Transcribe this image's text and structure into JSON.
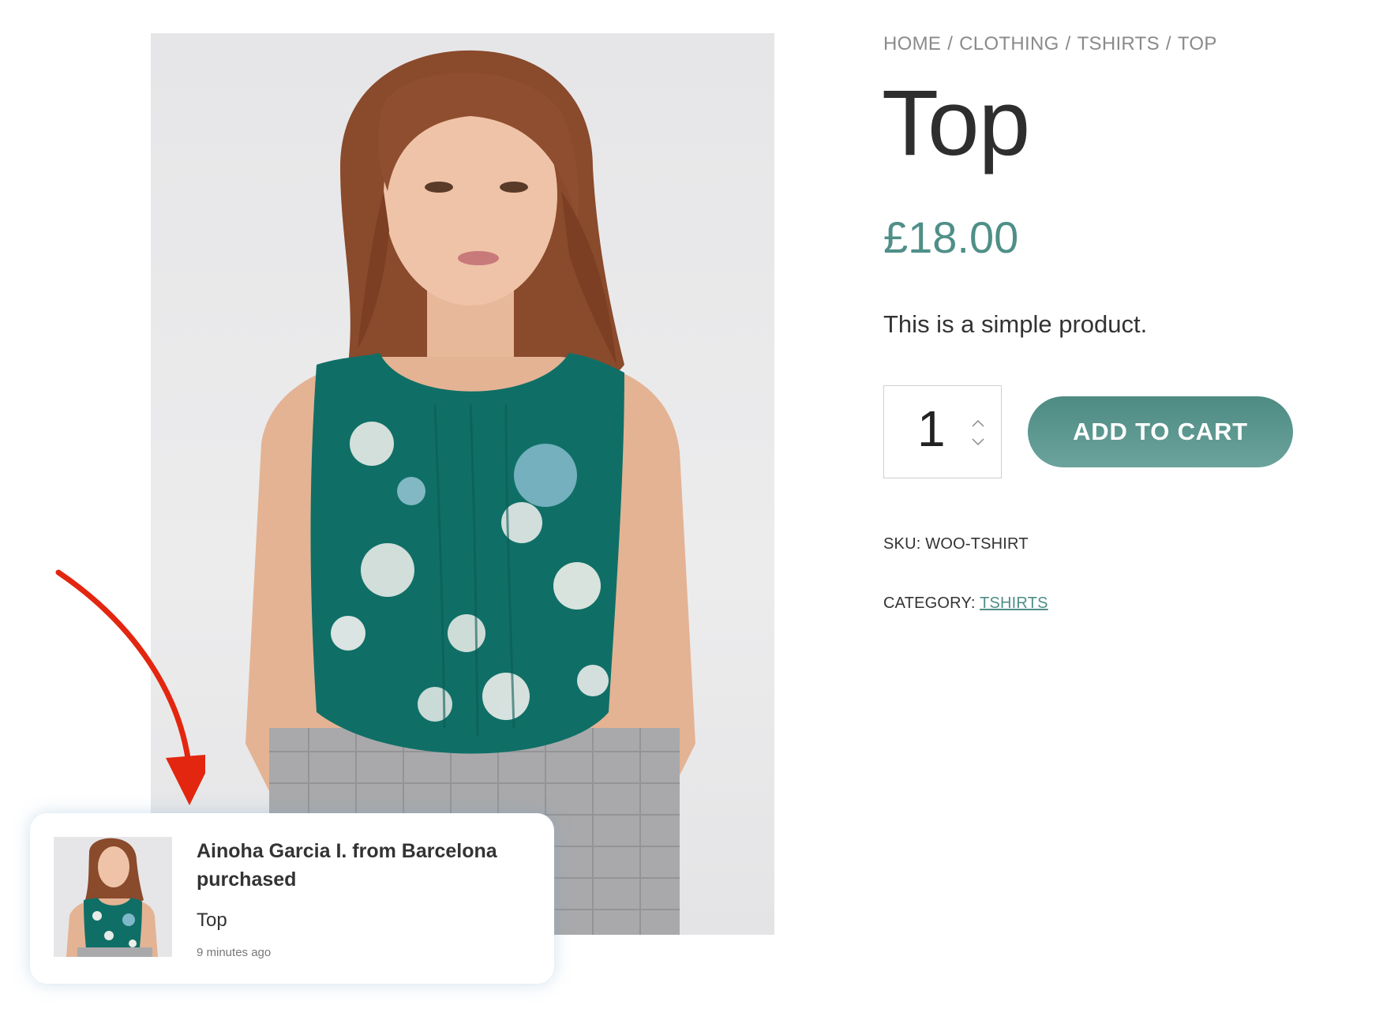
{
  "breadcrumb": {
    "items": [
      "HOME",
      "CLOTHING",
      "TSHIRTS",
      "TOP"
    ],
    "separator": "/"
  },
  "product": {
    "title": "Top",
    "price": "£18.00",
    "short_description": "This is a simple product.",
    "quantity": "1",
    "add_to_cart_label": "ADD TO CART",
    "sku_label": "SKU:",
    "sku_value": "WOO-TSHIRT",
    "category_label": "CATEGORY:",
    "category_value": "TSHIRTS",
    "image_alt": "Woman wearing a teal floral sleeveless top"
  },
  "notification": {
    "message": "Ainoha Garcia I. from Barcelona purchased",
    "product_name": "Top",
    "time_ago": "9 minutes ago"
  },
  "colors": {
    "accent": "#4f8f88",
    "button_gradient_top": "#4d8b83",
    "button_gradient_bottom": "#6ba39c",
    "annotation_arrow": "#e3260f"
  }
}
